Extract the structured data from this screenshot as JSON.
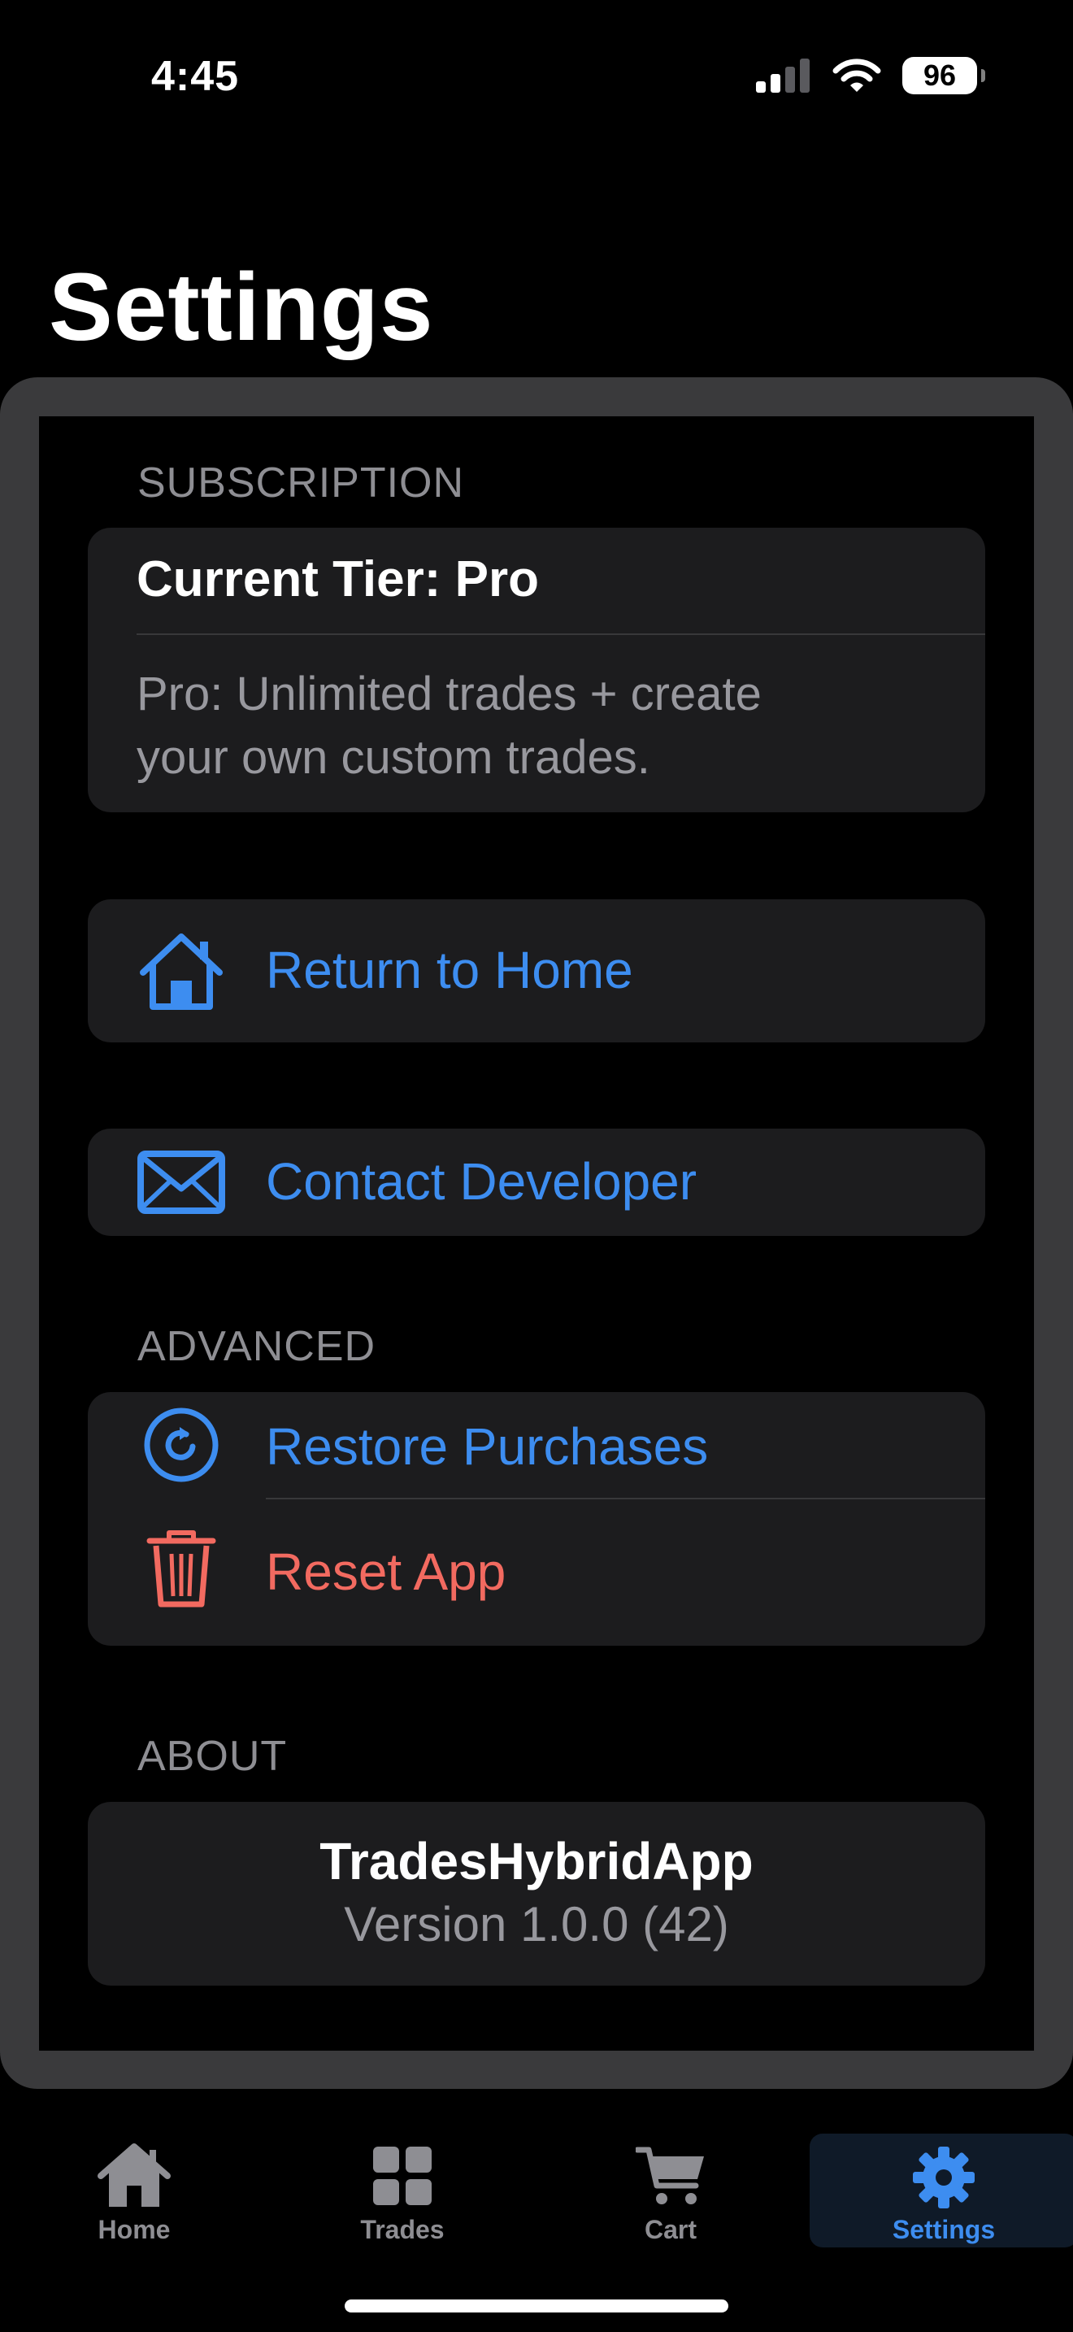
{
  "status_bar": {
    "time": "4:45",
    "battery": "96"
  },
  "page_title": "Settings",
  "subscription": {
    "header": "SUBSCRIPTION",
    "current_tier": "Current Tier: Pro",
    "description_line1": "Pro: Unlimited trades + create",
    "description_line2": "your own custom trades."
  },
  "actions": {
    "return_home": "Return to Home",
    "contact_developer": "Contact Developer"
  },
  "advanced": {
    "header": "ADVANCED",
    "restore": "Restore Purchases",
    "reset": "Reset App"
  },
  "about": {
    "header": "ABOUT",
    "app_name": "TradesHybridApp",
    "version": "Version 1.0.0 (42)"
  },
  "tabs": [
    {
      "label": "Home",
      "icon": "house-icon"
    },
    {
      "label": "Trades",
      "icon": "grid-icon"
    },
    {
      "label": "Cart",
      "icon": "cart-icon"
    },
    {
      "label": "Settings",
      "icon": "gear-icon",
      "active": true
    }
  ],
  "colors": {
    "accent": "#3d8df0",
    "destructive": "#f26a60",
    "card": "#1c1c1e",
    "secondary_text": "#8e8e93"
  }
}
